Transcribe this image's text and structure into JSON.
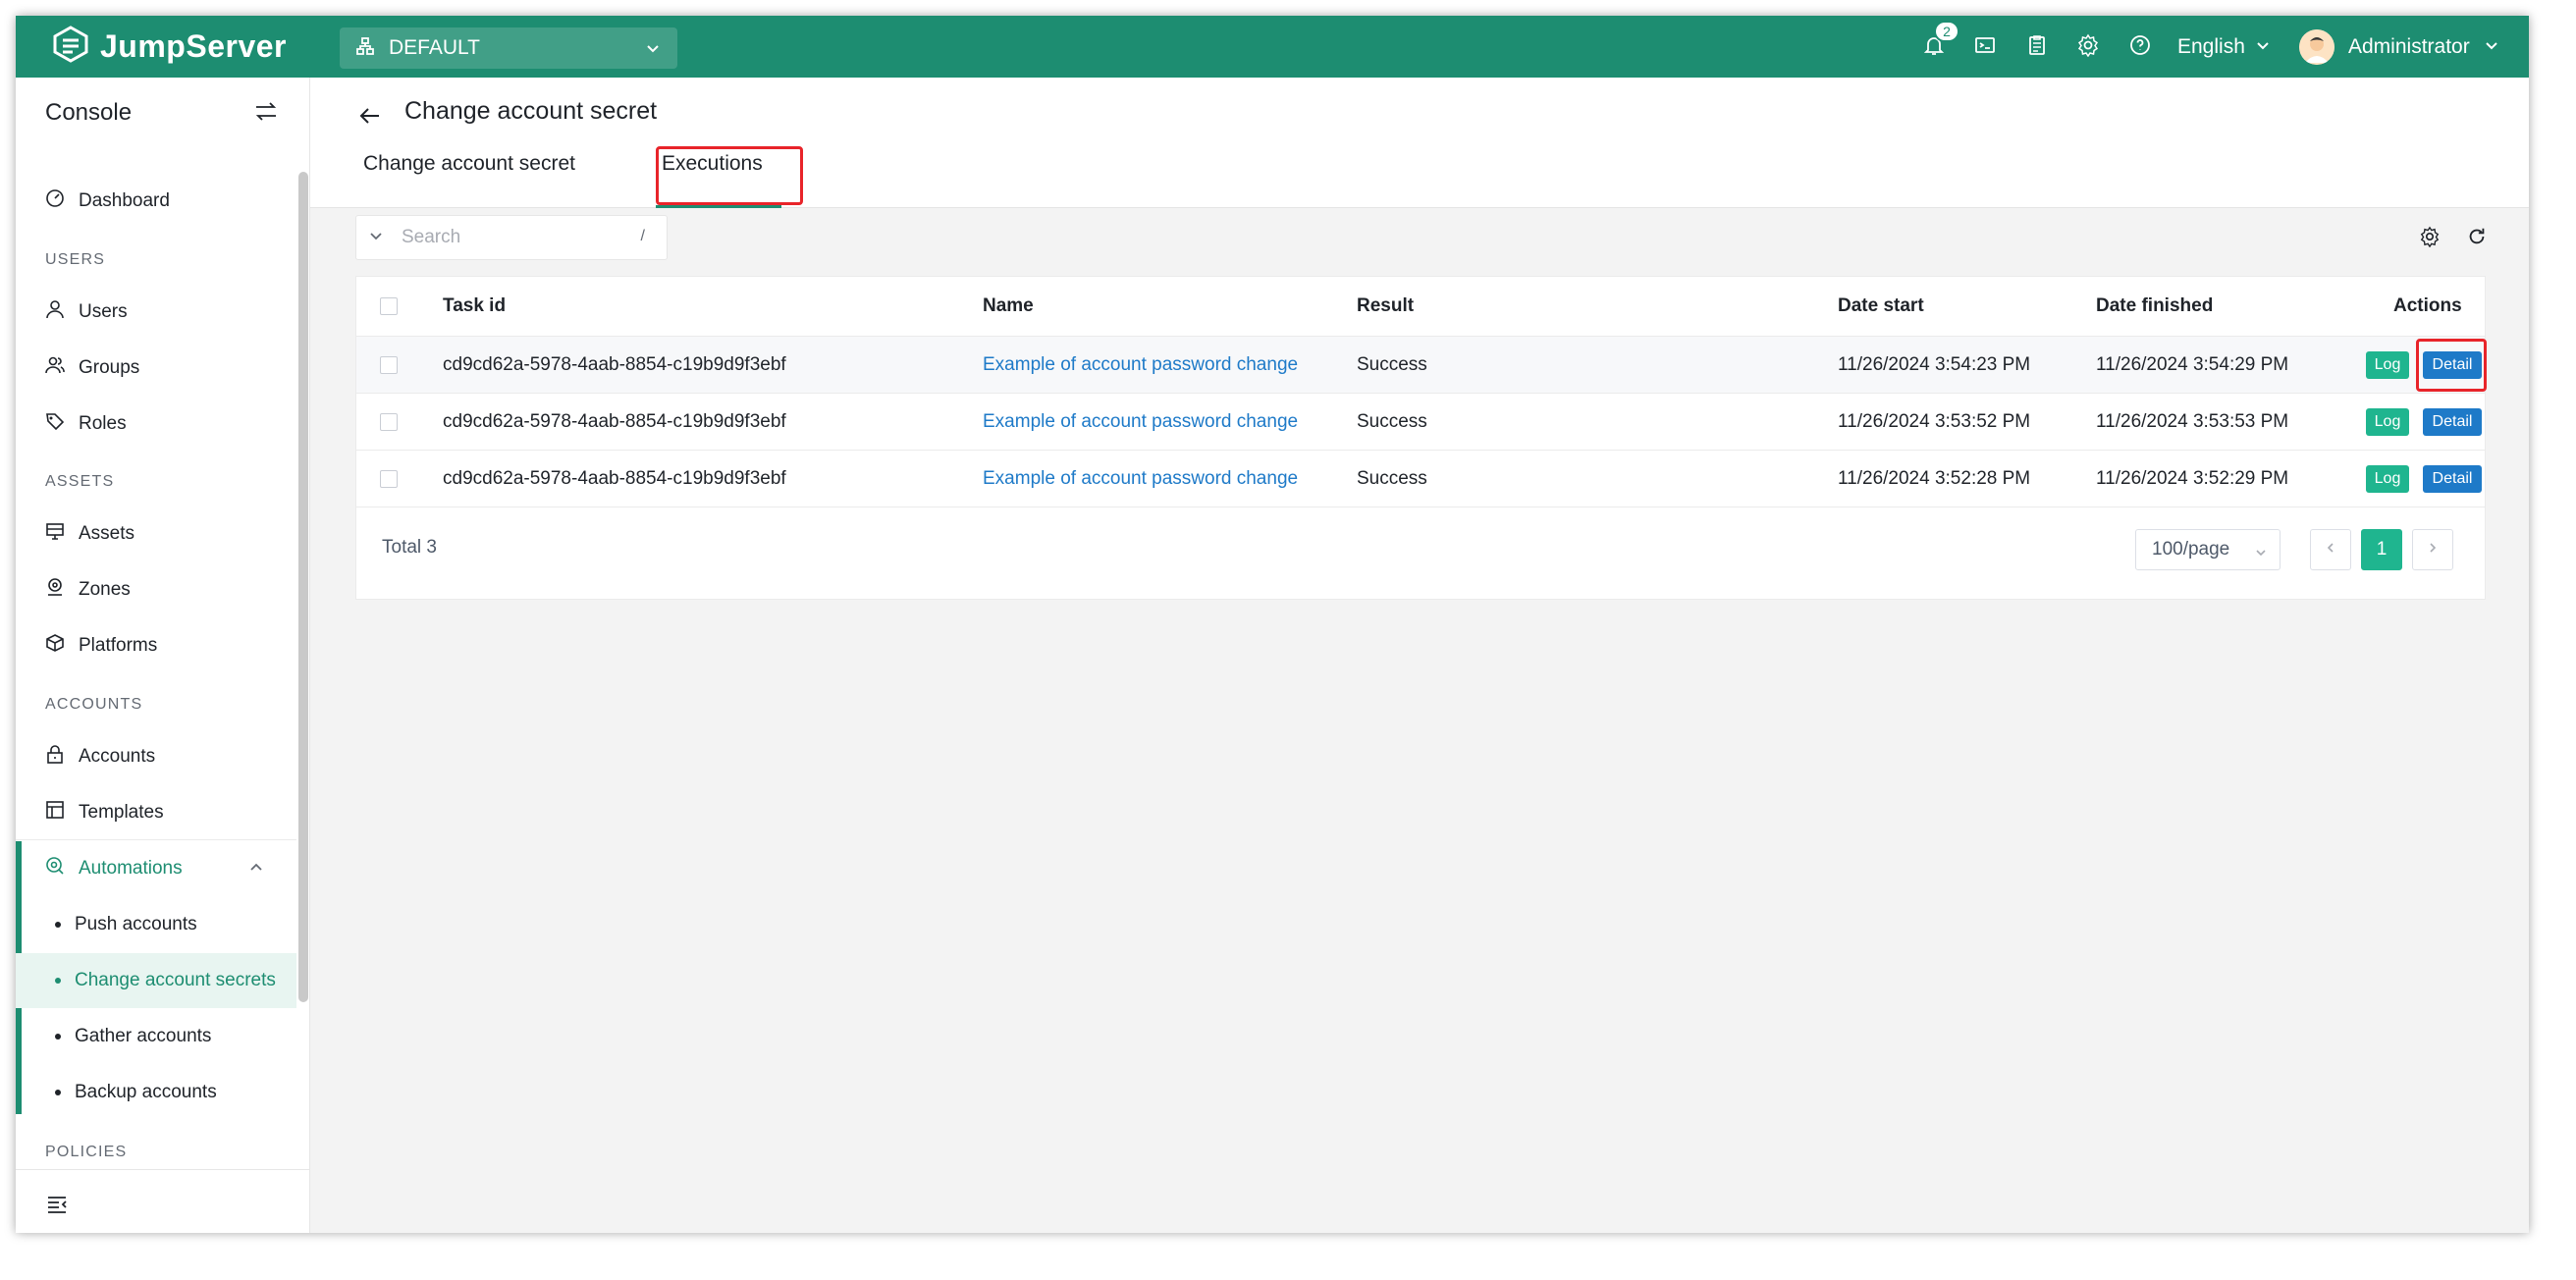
{
  "topbar": {
    "logo_text": "JumpServer",
    "org_label": "DEFAULT",
    "notification_count": "2",
    "language": "English",
    "user_name": "Administrator"
  },
  "sidebar": {
    "title": "Console",
    "items": {
      "dashboard": "Dashboard",
      "users_group": "USERS",
      "users": "Users",
      "groups": "Groups",
      "roles": "Roles",
      "assets_group": "ASSETS",
      "assets": "Assets",
      "zones": "Zones",
      "platforms": "Platforms",
      "accounts_group": "ACCOUNTS",
      "accounts": "Accounts",
      "templates": "Templates",
      "automations": "Automations",
      "push_accounts": "Push accounts",
      "change_account_secrets": "Change account secrets",
      "gather_accounts": "Gather accounts",
      "backup_accounts": "Backup accounts",
      "policies_group": "POLICIES"
    }
  },
  "page": {
    "title": "Change account secret",
    "tabs": [
      "Change account secret",
      "Executions"
    ],
    "active_tab": "Executions"
  },
  "search": {
    "placeholder": "Search",
    "shortcut": "/"
  },
  "table": {
    "columns": [
      "Task id",
      "Name",
      "Result",
      "Date start",
      "Date finished",
      "Actions"
    ],
    "rows": [
      {
        "task_id": "cd9cd62a-5978-4aab-8854-c19b9d9f3ebf",
        "name": "Example of account password change",
        "result": "Success",
        "date_start": "11/26/2024 3:54:23 PM",
        "date_finished": "11/26/2024 3:54:29 PM"
      },
      {
        "task_id": "cd9cd62a-5978-4aab-8854-c19b9d9f3ebf",
        "name": "Example of account password change",
        "result": "Success",
        "date_start": "11/26/2024 3:53:52 PM",
        "date_finished": "11/26/2024 3:53:53 PM"
      },
      {
        "task_id": "cd9cd62a-5978-4aab-8854-c19b9d9f3ebf",
        "name": "Example of account password change",
        "result": "Success",
        "date_start": "11/26/2024 3:52:28 PM",
        "date_finished": "11/26/2024 3:52:29 PM"
      }
    ],
    "log_label": "Log",
    "detail_label": "Detail"
  },
  "pagination": {
    "total": "Total 3",
    "page_size": "100/page",
    "current_page": "1"
  },
  "colors": {
    "brand": "#1d8d71",
    "link": "#1e7ac8",
    "log_button": "#1fb58f",
    "highlight": "#e8242a"
  }
}
